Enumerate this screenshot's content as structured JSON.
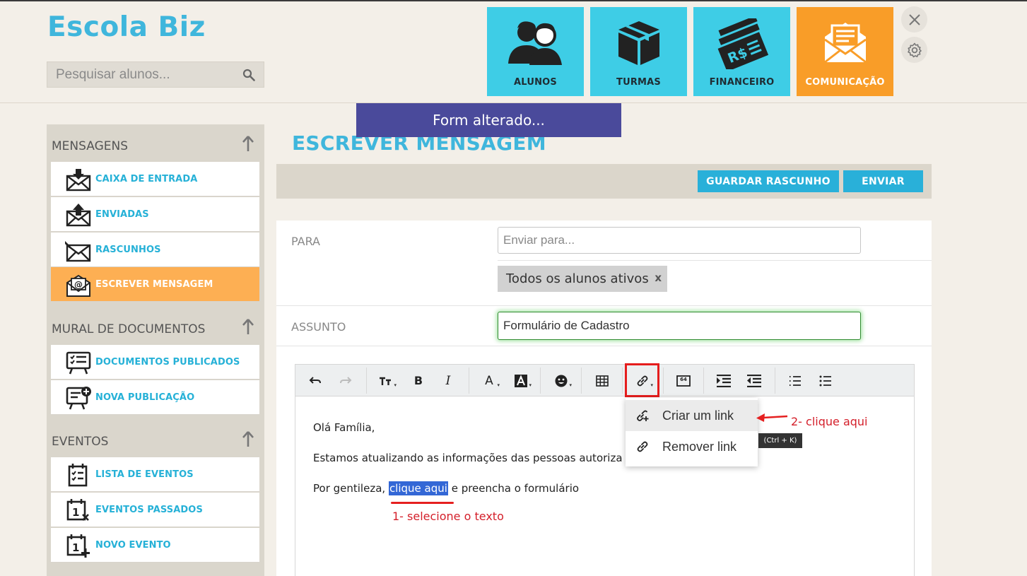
{
  "app": {
    "brand": "Escola Biz"
  },
  "search": {
    "placeholder": "Pesquisar alunos..."
  },
  "nav_tiles": [
    {
      "label": "ALUNOS",
      "icon": "students-icon"
    },
    {
      "label": "TURMAS",
      "icon": "box-icon"
    },
    {
      "label": "FINANCEIRO",
      "icon": "money-icon"
    },
    {
      "label": "COMUNICAÇÃO",
      "icon": "envelope-icon",
      "active": true
    }
  ],
  "toast": {
    "text": "Form alterado..."
  },
  "sidebar": {
    "sections": [
      {
        "title": "MENSAGENS",
        "items": [
          {
            "label": "CAIXA DE ENTRADA",
            "icon": "inbox-icon"
          },
          {
            "label": "ENVIADAS",
            "icon": "sent-icon"
          },
          {
            "label": "RASCUNHOS",
            "icon": "drafts-icon"
          },
          {
            "label": "ESCREVER MENSAGEM",
            "icon": "compose-icon",
            "active": true
          }
        ]
      },
      {
        "title": "MURAL DE DOCUMENTOS",
        "items": [
          {
            "label": "DOCUMENTOS PUBLICADOS",
            "icon": "board-list-icon"
          },
          {
            "label": "NOVA PUBLICAÇÃO",
            "icon": "board-add-icon"
          }
        ]
      },
      {
        "title": "EVENTOS",
        "items": [
          {
            "label": "LISTA DE EVENTOS",
            "icon": "calendar-list-icon"
          },
          {
            "label": "EVENTOS PASSADOS",
            "icon": "calendar-past-icon"
          },
          {
            "label": "NOVO EVENTO",
            "icon": "calendar-add-icon"
          }
        ]
      }
    ]
  },
  "main": {
    "title": "ESCREVER MENSAGEM",
    "save_draft": "GUARDAR RASCUNHO",
    "send": "ENVIAR"
  },
  "form": {
    "to_label": "PARA",
    "to_placeholder": "Enviar para...",
    "recipient_chip": "Todos os alunos ativos",
    "chip_remove": "x",
    "subject_label": "ASSUNTO",
    "subject_value": "Formulário de Cadastro"
  },
  "editor": {
    "line1": "Olá Família,",
    "line2": "Estamos atualizando as informações das pessoas autoriza",
    "line3_prefix": "Por gentileza, ",
    "line3_selected": "clique aqui",
    "line3_suffix": " e preencha o formulário",
    "toolbar_image_badge": "64"
  },
  "link_menu": {
    "create": "Criar um link",
    "remove": "Remover link",
    "shortcut": "(Ctrl + K)"
  },
  "annotations": {
    "step1": "1- selecione o texto",
    "step2": "2- clique aqui",
    "accent_red": "#e51d1d"
  },
  "colors": {
    "brand": "#3fb6dc",
    "tile_blue": "#3ecde6",
    "tile_orange": "#f99d28",
    "sidebar_active": "#fdaf53",
    "toast": "#4a4a9b",
    "button": "#29b0d9"
  }
}
